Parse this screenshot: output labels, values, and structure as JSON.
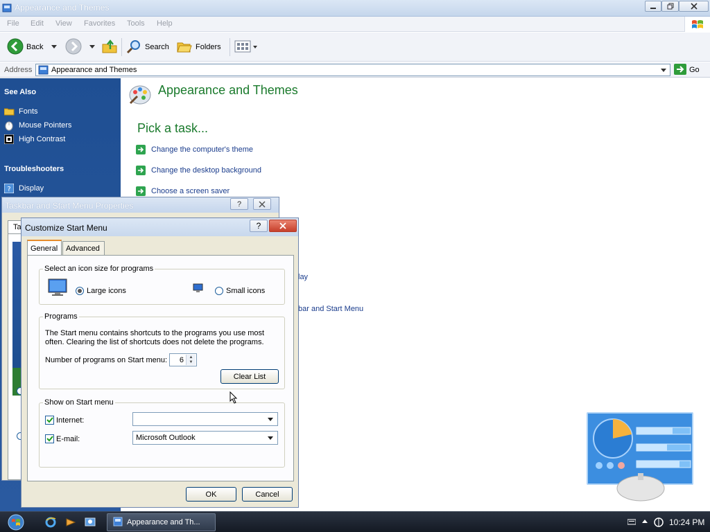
{
  "explorer": {
    "title": "Appearance and Themes",
    "menu": [
      "File",
      "Edit",
      "View",
      "Favorites",
      "Tools",
      "Help"
    ],
    "toolbar": {
      "back_label": "Back",
      "search_label": "Search",
      "folders_label": "Folders"
    },
    "address": {
      "label": "Address",
      "value": "Appearance and Themes",
      "go_label": "Go"
    },
    "sidebar": {
      "see_also_title": "See Also",
      "see_also": [
        {
          "label": "Fonts",
          "icon": "folder-icon"
        },
        {
          "label": "Mouse Pointers",
          "icon": "mouse-icon"
        },
        {
          "label": "High Contrast",
          "icon": "high-contrast-icon"
        }
      ],
      "troubleshooters_title": "Troubleshooters",
      "troubleshooters": [
        {
          "label": "Display",
          "icon": "help-icon"
        }
      ]
    },
    "main": {
      "header": "Appearance and Themes",
      "pick_task": "Pick a task...",
      "tasks": [
        "Change the computer's theme",
        "Change the desktop background",
        "Choose a screen saver"
      ],
      "partial_links": [
        "lay",
        "bar and Start Menu"
      ]
    }
  },
  "taskbar_props": {
    "title": "Taskbar and Start Menu Properties",
    "tab_stub": "Ta",
    "help_label": "?"
  },
  "dialog": {
    "title": "Customize Start Menu",
    "help_label": "?",
    "tabs": [
      "General",
      "Advanced"
    ],
    "icon_size": {
      "group_label": "Select an icon size for programs",
      "large_label": "Large icons",
      "small_label": "Small icons",
      "selected": "large"
    },
    "programs": {
      "group_label": "Programs",
      "description": "The Start menu contains shortcuts to the programs you use most often. Clearing the list of shortcuts does not delete the programs.",
      "count_label": "Number of programs on Start menu:",
      "count_value": "6",
      "clear_label": "Clear List"
    },
    "show": {
      "group_label": "Show on Start menu",
      "internet_label": "Internet:",
      "internet_checked": true,
      "internet_value": "",
      "email_label": "E-mail:",
      "email_checked": true,
      "email_value": "Microsoft Outlook"
    },
    "ok_label": "OK",
    "cancel_label": "Cancel"
  },
  "taskbar": {
    "task_label": "Appearance and Th...",
    "clock": "10:24 PM"
  },
  "colors": {
    "sidebar": "#1f4f93",
    "link": "#1a3c8c",
    "heading": "#1a7a2c",
    "dialog_bg": "#ece9d8"
  }
}
